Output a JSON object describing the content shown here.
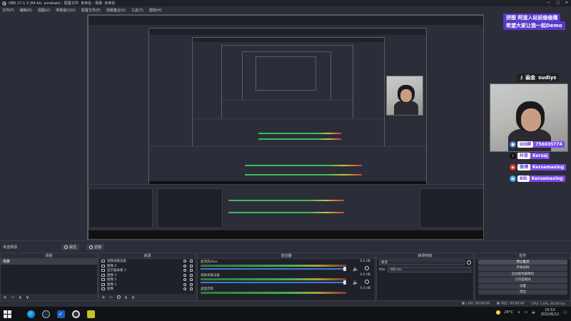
{
  "window": {
    "title": "OBS 27.1.3 (64-bit, windows) - 配置文件: 未命名 - 场景: 未命名",
    "controls": [
      "—",
      "□",
      "✕"
    ]
  },
  "menu": [
    "文件(F)",
    "编辑(E)",
    "视图(V)",
    "停靠窗口(D)",
    "配置文件(P)",
    "场景集合(S)",
    "工具(T)",
    "帮助(H)"
  ],
  "overlay": {
    "banner_top": "拼图  阿道入站前偷偷播",
    "banner_sub": "希望大家让我一起Demo",
    "name_label": "画金",
    "name_value": "sudiys",
    "tags": [
      {
        "icon": "qq",
        "label": "QQ群",
        "value": "756035774",
        "color": "#4a90e2"
      },
      {
        "icon": "douyin",
        "label": "抖音",
        "value": "Kersaj",
        "color": "#111111"
      },
      {
        "icon": "weibo",
        "label": "微博",
        "value": "Kersamaxing",
        "color": "#d8312c"
      },
      {
        "icon": "bilibili",
        "label": "B站",
        "value": "Kersamaxing",
        "color": "#3aa5e0"
      }
    ]
  },
  "scene_status": {
    "label": "未选择源",
    "properties": "属性",
    "filters": "滤镜"
  },
  "docks": {
    "scenes": {
      "title": "场景",
      "items": [
        "场景"
      ]
    },
    "sources": {
      "title": "来源",
      "items": [
        "视频采集设备",
        "图像 4",
        "显示器采集 2",
        "图像 3",
        "图像 2",
        "图像 1",
        "图像"
      ]
    },
    "mixer": {
      "title": "混音器",
      "channels": [
        {
          "name": "麦克风/Aux",
          "db": "0.0 dB"
        },
        {
          "name": "视频采集设备",
          "db": "0.0 dB"
        },
        {
          "name": "桌面音频",
          "db": "0.0 dB"
        }
      ]
    },
    "transitions": {
      "title": "转场特效",
      "type": "渐变",
      "duration_label": "时长",
      "duration_value": "300 ms"
    },
    "controls": {
      "title": "控件",
      "buttons": [
        "停止推流",
        "开始录制",
        "启动虚拟摄像机",
        "工作室模式",
        "设置",
        "退出"
      ]
    }
  },
  "footer_icons": [
    "+",
    "−",
    "∧",
    "∨"
  ],
  "statusbar": {
    "live": "LIVE: 00:00:00",
    "rec": "REC: 00:00:00",
    "cpu": "CPU: 1.0%, 60.00 fps"
  },
  "taskbar": {
    "temperature": "24°C",
    "time": "15:53",
    "date": "2022/6/12"
  },
  "nest": {
    "title": "OBS 27.1.3 (64-bit, windows) - 配置文件: 未命名 - 场景: 未命名"
  }
}
